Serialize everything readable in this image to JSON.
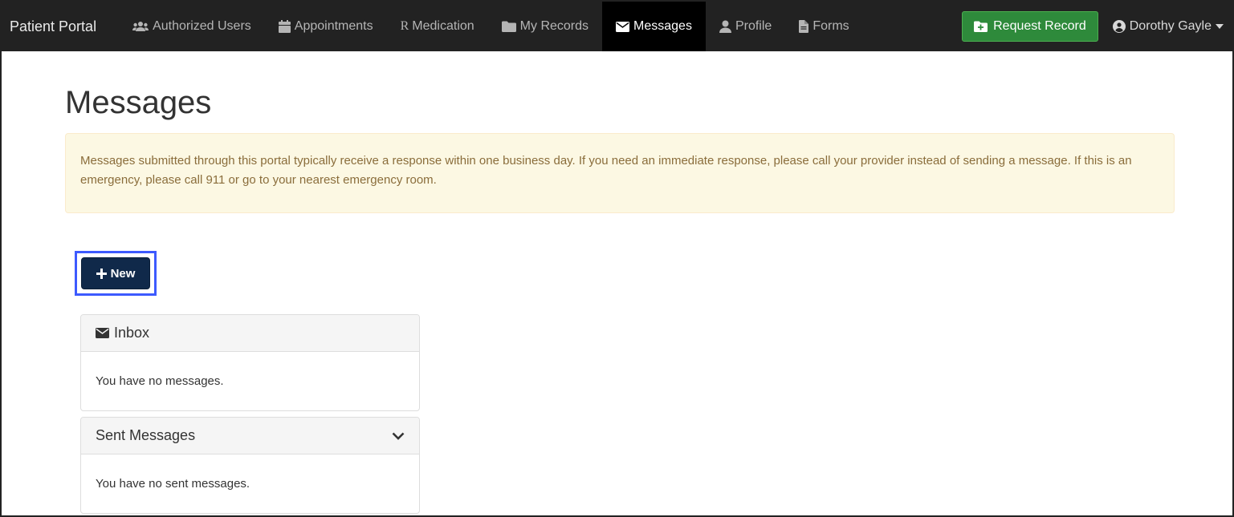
{
  "navbar": {
    "brand": "Patient Portal",
    "items": [
      {
        "label": "Authorized Users",
        "icon": "users-icon"
      },
      {
        "label": "Appointments",
        "icon": "calendar-icon"
      },
      {
        "label": "Medication",
        "icon": "rx-icon"
      },
      {
        "label": "My Records",
        "icon": "folder-icon"
      },
      {
        "label": "Messages",
        "icon": "envelope-icon",
        "active": true
      },
      {
        "label": "Profile",
        "icon": "user-icon"
      },
      {
        "label": "Forms",
        "icon": "file-icon"
      }
    ],
    "request_button": "Request Record",
    "user_name": "Dorothy Gayle"
  },
  "page": {
    "title": "Messages",
    "alert": "Messages submitted through this portal typically receive a response within one business day. If you need an immediate response, please call your provider instead of sending a message. If this is an emergency, please call 911 or go to your nearest emergency room.",
    "new_button": "New"
  },
  "inbox": {
    "heading": "Inbox",
    "empty_text": "You have no messages."
  },
  "sent": {
    "heading": "Sent Messages",
    "empty_text": "You have no sent messages."
  },
  "colors": {
    "navbar_bg": "#222222",
    "active_bg": "#000000",
    "request_green": "#2e8a3b",
    "new_button_navy": "#10294a",
    "highlight_blue": "#3d5afe",
    "alert_bg": "#fcf8e3",
    "alert_text": "#8a6d3b"
  }
}
